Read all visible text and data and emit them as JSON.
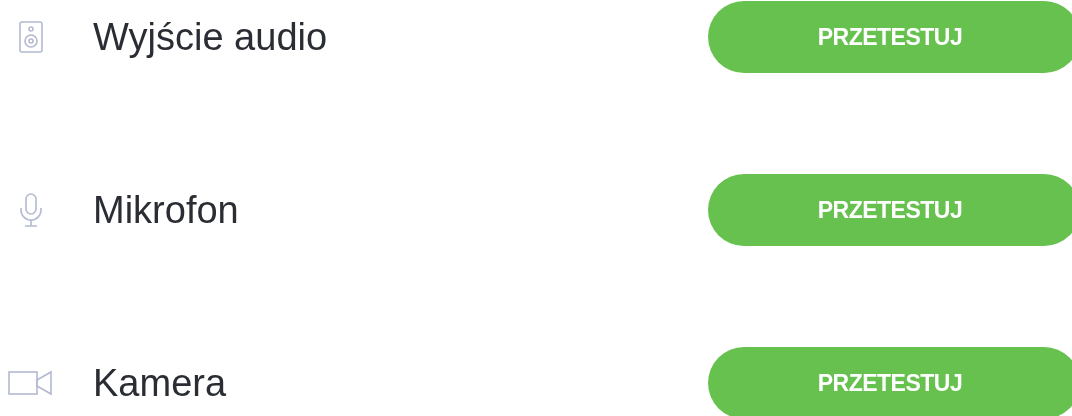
{
  "devices": [
    {
      "kind": "speaker",
      "label": "Wyjście audio",
      "button": "PRZETESTUJ"
    },
    {
      "kind": "microphone",
      "label": "Mikrofon",
      "button": "PRZETESTUJ"
    },
    {
      "kind": "camera",
      "label": "Kamera",
      "button": "PRZETESTUJ"
    }
  ]
}
